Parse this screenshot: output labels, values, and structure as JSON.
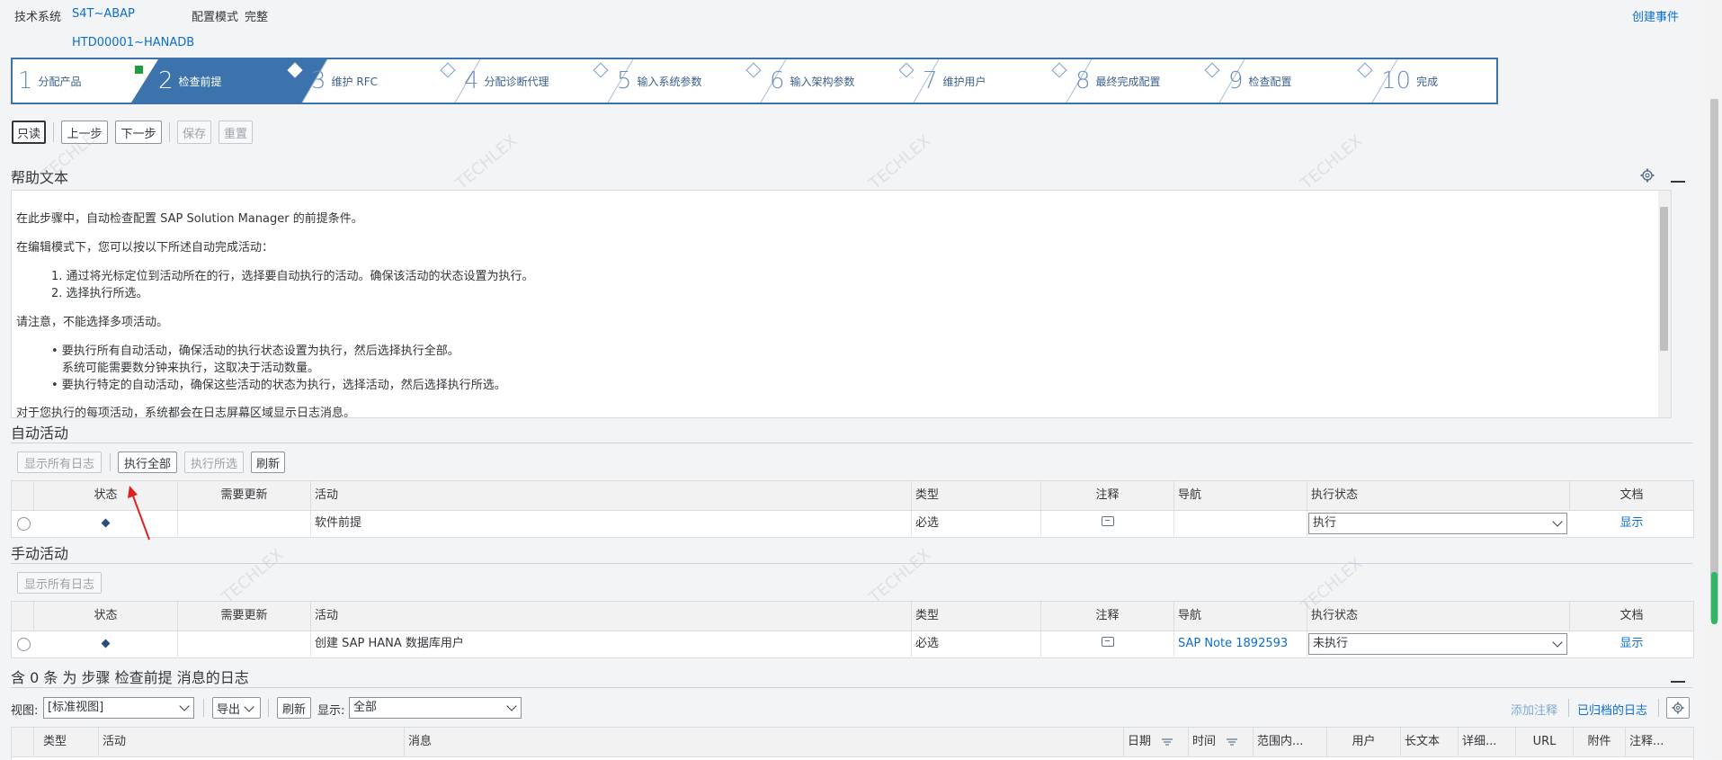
{
  "header": {
    "tech_system_label": "技术系统",
    "tech_system_value": "S4T~ABAP",
    "tech_system_db": "HTD00001~HANADB",
    "config_mode_label": "配置模式",
    "config_mode_value": "完整",
    "create_event_link": "创建事件"
  },
  "wizard": {
    "steps": [
      {
        "num": "1",
        "label": "分配产品"
      },
      {
        "num": "2",
        "label": "检查前提"
      },
      {
        "num": "3",
        "label": "维护 RFC"
      },
      {
        "num": "4",
        "label": "分配诊断代理"
      },
      {
        "num": "5",
        "label": "输入系统参数"
      },
      {
        "num": "6",
        "label": "输入架构参数"
      },
      {
        "num": "7",
        "label": "维护用户"
      },
      {
        "num": "8",
        "label": "最终完成配置"
      },
      {
        "num": "9",
        "label": "检查配置"
      },
      {
        "num": "10",
        "label": "完成"
      }
    ],
    "active_step": 2,
    "accent": "#3d73ac"
  },
  "toolbar": {
    "readonly": "只读",
    "prev": "上一步",
    "next": "下一步",
    "save": "保存",
    "reset": "重置"
  },
  "help": {
    "title": "帮助文本",
    "lines": [
      "在此步骤中，自动检查配置 SAP Solution Manager 的前提条件。",
      "在编辑模式下，您可以按以下所述自动完成活动：",
      "1. 通过将光标定位到活动所在的行，选择要自动执行的活动。确保该活动的状态设置为执行。",
      "2. 选择执行所选。",
      "请注意，不能选择多项活动。",
      "• 要执行所有自动活动，确保活动的执行状态设置为执行，然后选择执行全部。",
      "系统可能需要数分钟来执行，这取决于活动数量。",
      "• 要执行特定的自动活动，确保这些活动的状态为执行，选择活动，然后选择执行所选。",
      "对于您执行的每项活动，系统都会在日志屏幕区域显示日志消息。"
    ]
  },
  "auto": {
    "title": "自动活动",
    "buttons": {
      "show_all_logs": "显示所有日志",
      "execute_all": "执行全部",
      "execute_selected": "执行所选",
      "refresh": "刷新"
    },
    "columns": [
      "状态",
      "需要更新",
      "活动",
      "类型",
      "注释",
      "导航",
      "执行状态",
      "文档"
    ],
    "rows": [
      {
        "activity": "软件前提",
        "type": "必选",
        "nav": "",
        "exec_status": "执行",
        "doc": "显示"
      }
    ]
  },
  "manual": {
    "title": "手动活动",
    "buttons": {
      "show_all_logs": "显示所有日志"
    },
    "columns": [
      "状态",
      "需要更新",
      "活动",
      "类型",
      "注释",
      "导航",
      "执行状态",
      "文档"
    ],
    "rows": [
      {
        "activity": "创建 SAP HANA 数据库用户",
        "type": "必选",
        "nav": "SAP Note 1892593",
        "exec_status": "未执行",
        "doc": "显示"
      }
    ]
  },
  "log": {
    "title": "含 0 条 为 步骤 检查前提 消息的日志",
    "view_label": "视图:",
    "view_value": "[标准视图]",
    "export": "导出",
    "refresh": "刷新",
    "show_label": "显示:",
    "show_value": "全部",
    "add_note": "添加注释",
    "archived_log": "已归档的日志",
    "columns": [
      "类型",
      "活动",
      "消息",
      "日期",
      "时间",
      "范围内...",
      "用户",
      "长文本",
      "详细...",
      "URL",
      "附件",
      "注释..."
    ]
  },
  "watermark_text": "TECHLEX"
}
